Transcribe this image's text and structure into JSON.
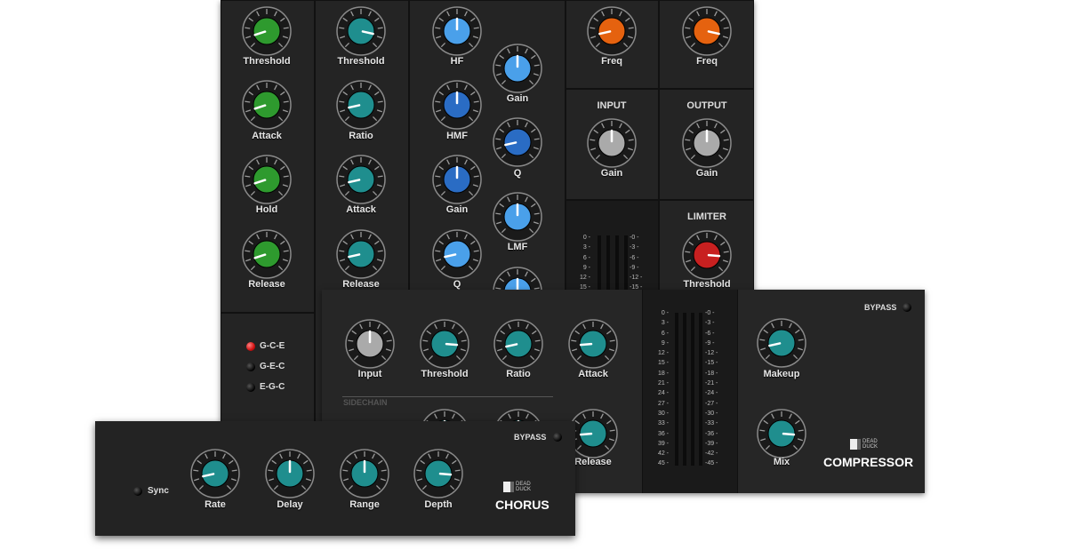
{
  "colors": {
    "green": "#2e9a2e",
    "teal": "#1f8e8e",
    "lightblue": "#4aa0ea",
    "blue": "#2a6cc4",
    "orange": "#e5620f",
    "grey": "#aaaaaa",
    "red": "#c82020"
  },
  "gate": {
    "knobs": [
      {
        "label": "Threshold",
        "value": 0.1,
        "color": "green"
      },
      {
        "label": "Attack",
        "value": 0.1,
        "color": "green"
      },
      {
        "label": "Hold",
        "value": 0.1,
        "color": "green"
      },
      {
        "label": "Release",
        "value": 0.1,
        "color": "green"
      }
    ],
    "modes": [
      {
        "label": "G-C-E",
        "on": true
      },
      {
        "label": "G-E-C",
        "on": false
      },
      {
        "label": "E-G-C",
        "on": false
      }
    ]
  },
  "comp_strip": {
    "knobs": [
      {
        "label": "Threshold",
        "value": 0.88,
        "color": "teal"
      },
      {
        "label": "Ratio",
        "value": 0.12,
        "color": "teal"
      },
      {
        "label": "Attack",
        "value": 0.12,
        "color": "teal"
      },
      {
        "label": "Release",
        "value": 0.12,
        "color": "teal"
      }
    ]
  },
  "eq": {
    "left": [
      {
        "label": "HF",
        "value": 0.5,
        "color": "lightblue"
      },
      {
        "label": "HMF",
        "value": 0.5,
        "color": "blue"
      },
      {
        "label": "Gain",
        "value": 0.5,
        "color": "blue"
      },
      {
        "label": "Q",
        "value": 0.12,
        "color": "lightblue"
      }
    ],
    "right": [
      {
        "label": "Gain",
        "value": 0.5,
        "color": "lightblue"
      },
      {
        "label": "Q",
        "value": 0.12,
        "color": "blue"
      },
      {
        "label": "LMF",
        "value": 0.5,
        "color": "lightblue"
      },
      {
        "label": "",
        "value": 0.5,
        "color": "lightblue"
      }
    ]
  },
  "filters": {
    "left": {
      "label": "Freq",
      "value": 0.12,
      "color": "orange"
    },
    "right": {
      "label": "Freq",
      "value": 0.88,
      "color": "orange"
    }
  },
  "input": {
    "header": "INPUT",
    "knob": {
      "label": "Gain",
      "value": 0.5,
      "color": "grey"
    }
  },
  "output": {
    "header": "OUTPUT",
    "knob": {
      "label": "Gain",
      "value": 0.5,
      "color": "grey"
    }
  },
  "limiter": {
    "header": "LIMITER",
    "knob": {
      "label": "Threshold",
      "value": 0.85,
      "color": "red"
    }
  },
  "strip_meter": {
    "left": [
      "0",
      "3",
      "6",
      "9",
      "12",
      "15"
    ],
    "right": [
      "-0",
      "-3",
      "-6",
      "-9",
      "-12",
      "-15"
    ]
  },
  "compressor": {
    "bypass": "BYPASS",
    "sidechain": "SIDECHAIN",
    "brand": "COMPRESSOR",
    "logo": "DEAD DUCK",
    "knobs": [
      {
        "label": "Input",
        "value": 0.5,
        "color": "grey"
      },
      {
        "label": "Threshold",
        "value": 0.85,
        "color": "teal"
      },
      {
        "label": "Ratio",
        "value": 0.12,
        "color": "teal"
      },
      {
        "label": "Attack",
        "value": 0.15,
        "color": "teal"
      },
      {
        "label": "",
        "value": 0.5,
        "color": "teal"
      },
      {
        "label": "",
        "value": 0.5,
        "color": "teal"
      },
      {
        "label": "Release",
        "value": 0.15,
        "color": "teal"
      },
      {
        "label": "Makeup",
        "value": 0.12,
        "color": "teal"
      },
      {
        "label": "Mix",
        "value": 0.85,
        "color": "teal"
      }
    ],
    "meter_left": [
      "0",
      "3",
      "6",
      "9",
      "12",
      "15",
      "18",
      "21",
      "24",
      "27",
      "30",
      "33",
      "36",
      "39",
      "42",
      "45"
    ],
    "meter_right": [
      "-0",
      "-3",
      "-6",
      "-9",
      "-12",
      "-15",
      "-18",
      "-21",
      "-24",
      "-27",
      "-30",
      "-33",
      "-36",
      "-39",
      "-42",
      "-45"
    ]
  },
  "chorus": {
    "bypass": "BYPASS",
    "sync": "Sync",
    "brand": "CHORUS",
    "logo": "DEAD DUCK",
    "knobs": [
      {
        "label": "Rate",
        "value": 0.12,
        "color": "teal"
      },
      {
        "label": "Delay",
        "value": 0.5,
        "color": "teal"
      },
      {
        "label": "Range",
        "value": 0.5,
        "color": "teal"
      },
      {
        "label": "Depth",
        "value": 0.85,
        "color": "teal"
      }
    ]
  }
}
